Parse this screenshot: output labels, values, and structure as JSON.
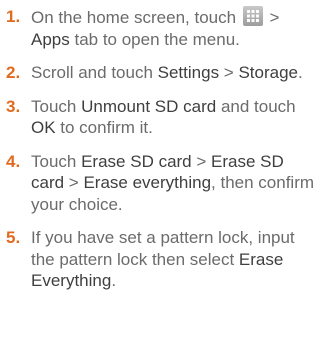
{
  "steps": [
    {
      "number": "1.",
      "parts": [
        {
          "text": "On the home screen, touch ",
          "em": false
        },
        {
          "icon": "apps-grid-icon"
        },
        {
          "text": " > ",
          "em": false
        },
        {
          "text": "Apps",
          "em": true
        },
        {
          "text": " tab to open the menu.",
          "em": false
        }
      ]
    },
    {
      "number": "2.",
      "parts": [
        {
          "text": "Scroll and touch ",
          "em": false
        },
        {
          "text": "Settings",
          "em": true
        },
        {
          "text": " > ",
          "em": false
        },
        {
          "text": "Storage",
          "em": true
        },
        {
          "text": ".",
          "em": false
        }
      ]
    },
    {
      "number": "3.",
      "parts": [
        {
          "text": "Touch ",
          "em": false
        },
        {
          "text": "Unmount SD card",
          "em": true
        },
        {
          "text": " and touch ",
          "em": false
        },
        {
          "text": "OK",
          "em": true
        },
        {
          "text": " to confirm it.",
          "em": false
        }
      ]
    },
    {
      "number": "4.",
      "parts": [
        {
          "text": "Touch ",
          "em": false
        },
        {
          "text": "Erase SD card",
          "em": true
        },
        {
          "text": " > ",
          "em": false
        },
        {
          "text": "Erase SD card",
          "em": true
        },
        {
          "text": " > ",
          "em": false
        },
        {
          "text": "Erase everything",
          "em": true
        },
        {
          "text": ", then confirm your choice.",
          "em": false
        }
      ]
    },
    {
      "number": "5.",
      "parts": [
        {
          "text": "If you have set a pattern lock, input the pattern lock then select ",
          "em": false
        },
        {
          "text": "Erase Everything",
          "em": true
        },
        {
          "text": ".",
          "em": false
        }
      ]
    }
  ],
  "colors": {
    "step_number": "#e06b1f",
    "body_text": "#6b6b6b",
    "emphasis_text": "#3f3f3f"
  }
}
